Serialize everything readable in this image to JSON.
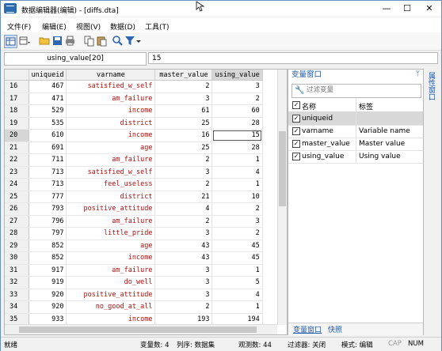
{
  "window": {
    "title": "数据编辑器(编辑) - [diffs.dta]",
    "min": "—",
    "max": "☐",
    "close": "✕"
  },
  "menu": [
    "文件(F)",
    "编辑(E)",
    "视图(V)",
    "数据(D)",
    "工具(T)"
  ],
  "field": {
    "varname": "using_value[20]",
    "value": "15"
  },
  "grid": {
    "headers": [
      "uniqueid",
      "varname",
      "master_value",
      "using_value"
    ],
    "selected_header": "using_value",
    "rows": [
      {
        "n": "16",
        "id": "467",
        "var": "satisfied_w_self",
        "m": "2",
        "u": "3"
      },
      {
        "n": "17",
        "id": "471",
        "var": "am_failure",
        "m": "3",
        "u": "2"
      },
      {
        "n": "18",
        "id": "529",
        "var": "income",
        "m": "61",
        "u": "60"
      },
      {
        "n": "19",
        "id": "535",
        "var": "district",
        "m": "25",
        "u": "28"
      },
      {
        "n": "20",
        "id": "610",
        "var": "income",
        "m": "16",
        "u": "15"
      },
      {
        "n": "21",
        "id": "691",
        "var": "age",
        "m": "25",
        "u": "28"
      },
      {
        "n": "22",
        "id": "711",
        "var": "am_failure",
        "m": "2",
        "u": "1"
      },
      {
        "n": "23",
        "id": "713",
        "var": "satisfied_w_self",
        "m": "3",
        "u": "4"
      },
      {
        "n": "24",
        "id": "713",
        "var": "feel_useless",
        "m": "2",
        "u": "1"
      },
      {
        "n": "25",
        "id": "777",
        "var": "district",
        "m": "21",
        "u": "10"
      },
      {
        "n": "26",
        "id": "793",
        "var": "positive_attitude",
        "m": "4",
        "u": "2"
      },
      {
        "n": "27",
        "id": "796",
        "var": "am_failure",
        "m": "2",
        "u": "3"
      },
      {
        "n": "28",
        "id": "797",
        "var": "little_pride",
        "m": "3",
        "u": "2"
      },
      {
        "n": "29",
        "id": "852",
        "var": "age",
        "m": "43",
        "u": "45"
      },
      {
        "n": "30",
        "id": "852",
        "var": "income",
        "m": "43",
        "u": "45"
      },
      {
        "n": "31",
        "id": "917",
        "var": "am_failure",
        "m": "3",
        "u": "1"
      },
      {
        "n": "32",
        "id": "919",
        "var": "do_well",
        "m": "3",
        "u": "5"
      },
      {
        "n": "33",
        "id": "920",
        "var": "positive_attitude",
        "m": "3",
        "u": "4"
      },
      {
        "n": "34",
        "id": "920",
        "var": "no_good_at_all",
        "m": "2",
        "u": "1"
      },
      {
        "n": "35",
        "id": "933",
        "var": "income",
        "m": "193",
        "u": "194"
      }
    ],
    "current_row": "20"
  },
  "panel": {
    "title": "变量窗口",
    "pin": "ᛘ",
    "filter_placeholder": "过滤变量",
    "col_name": "名称",
    "col_label": "标签",
    "vars": [
      {
        "name": "uniqueid",
        "label": ""
      },
      {
        "name": "varname",
        "label": "Variable name"
      },
      {
        "name": "master_value",
        "label": "Master value"
      },
      {
        "name": "using_value",
        "label": "Using value"
      }
    ],
    "tabs": [
      "变量窗口",
      "快照"
    ],
    "side_tab": "属性窗口"
  },
  "status": {
    "ready": "就绪",
    "vars": "变量数: 4",
    "order": "列序: 数据集",
    "obs": "观测数: 44",
    "filter": "过滤器: 关闭",
    "mode": "模式: 编辑",
    "cap": "CAP",
    "num": "NUM"
  }
}
